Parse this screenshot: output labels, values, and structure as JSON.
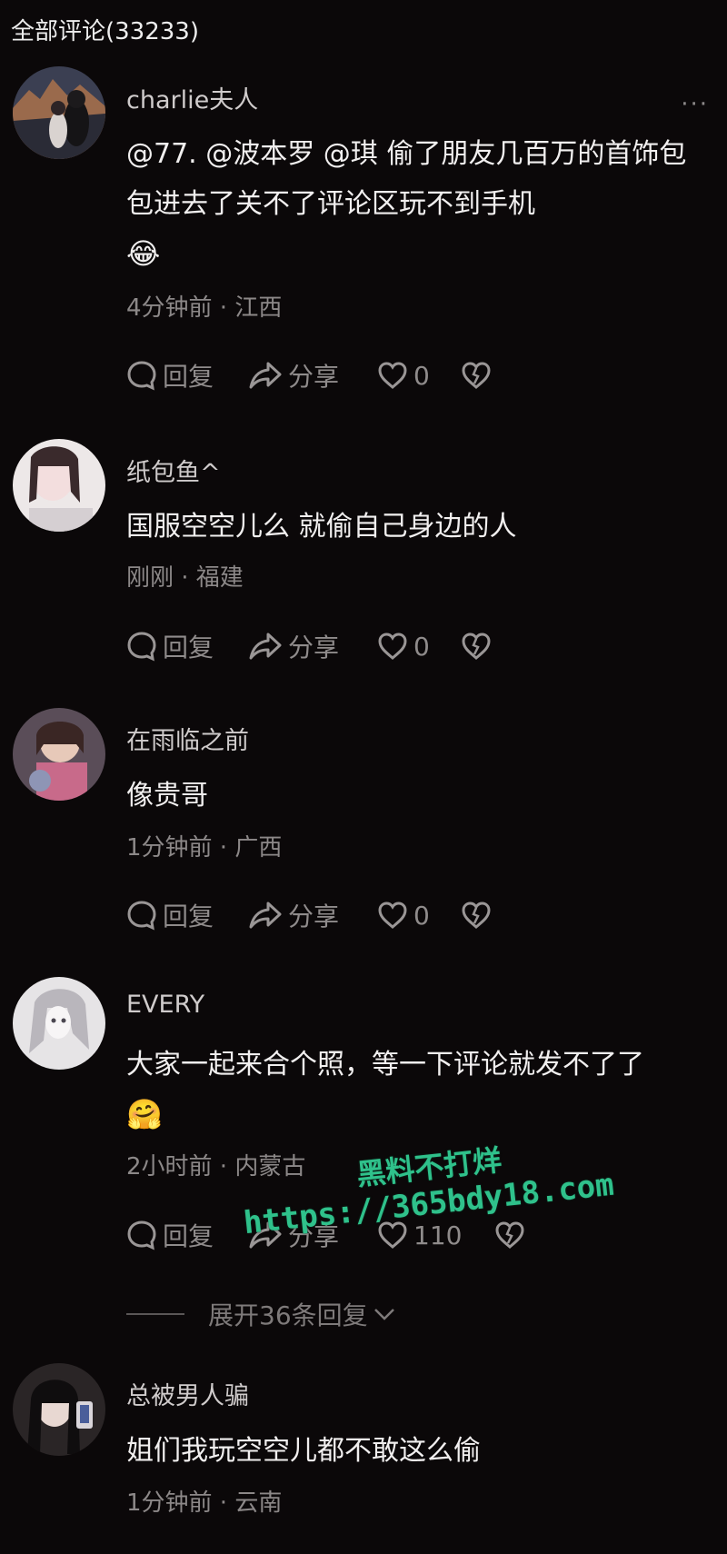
{
  "header": {
    "title": "全部评论(33233)"
  },
  "comments": [
    {
      "user": "charlie夫人",
      "more": "···",
      "text": "@77.  @波本罗  @琪  偷了朋友几百万的首饰包包进去了关不了评论区玩不到手机",
      "emoji": "😂",
      "meta": "4分钟前 · 江西",
      "reply": "回复",
      "share": "分享",
      "likes": "0"
    },
    {
      "user": "纸包鱼^",
      "text": "国服空空儿么 就偷自己身边的人",
      "meta": "刚刚 · 福建",
      "reply": "回复",
      "share": "分享",
      "likes": "0"
    },
    {
      "user": "在雨临之前",
      "text": "像贵哥",
      "meta": "1分钟前 · 广西",
      "reply": "回复",
      "share": "分享",
      "likes": "0"
    },
    {
      "user": "EVERY",
      "text": "大家一起来合个照，等一下评论就发不了了",
      "emoji": "🤗",
      "meta": "2小时前 · 内蒙古",
      "reply": "回复",
      "share": "分享",
      "likes": "110",
      "expand": "展开36条回复"
    },
    {
      "user": "总被男人骗",
      "text": "姐们我玩空空儿都不敢这么偷",
      "meta": "1分钟前 · 云南"
    }
  ],
  "watermark": {
    "line1": "黑料不打烊",
    "line2": "https://365bdy18.com"
  },
  "icons": {
    "reply": "speech-bubble-icon",
    "share": "share-arrow-icon",
    "like": "heart-icon",
    "dislike": "broken-heart-icon",
    "expand": "chevron-down-icon"
  },
  "colors": {
    "background": "#0b0809",
    "watermark": "#2fc18b"
  }
}
